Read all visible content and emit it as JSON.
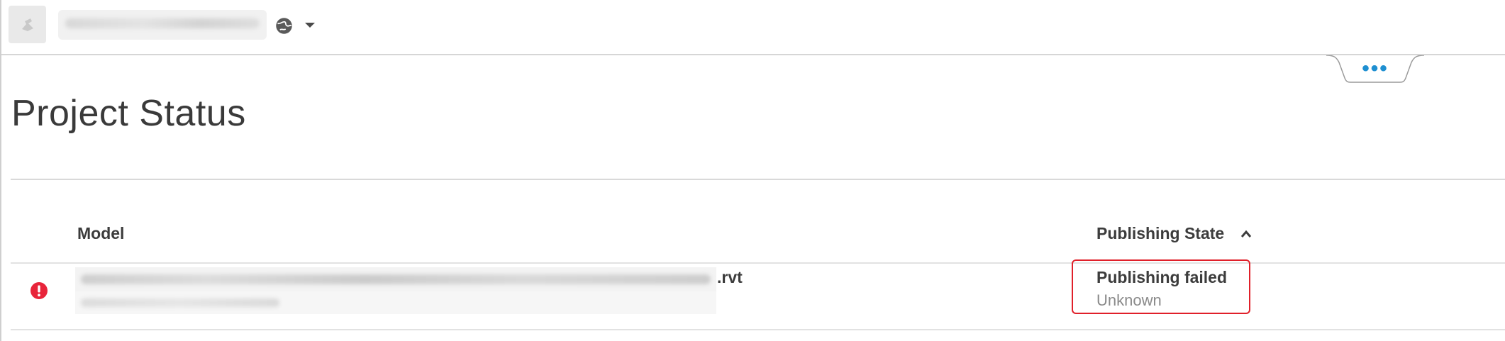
{
  "header": {
    "logo_icon": "app-logo-icon",
    "project_name": "",
    "region_icon": "globe-icon",
    "region_caret_icon": "caret-down-icon"
  },
  "more_tab": {
    "label": "•••",
    "icon": "more-dots-icon"
  },
  "page": {
    "title": "Project Status"
  },
  "table": {
    "columns": {
      "model": "Model",
      "publishing_state": "Publishing State"
    },
    "sort": {
      "column": "publishing_state",
      "direction": "ascending",
      "icon": "chevron-up-icon"
    },
    "rows": [
      {
        "status_icon": "error-icon",
        "model_extension": ".rvt",
        "publishing_state": "Publishing failed",
        "publishing_detail": "Unknown"
      }
    ]
  },
  "colors": {
    "error": "#e8243a",
    "highlight_border": "#e0202a",
    "accent": "#1e8fd1",
    "text": "#3c3c3c",
    "muted_text": "#8a8a8a"
  }
}
